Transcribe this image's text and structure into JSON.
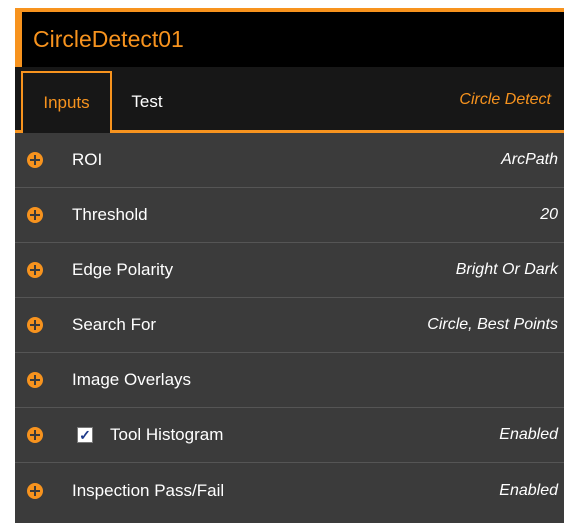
{
  "colors": {
    "accent": "#f7931e",
    "panel_bg": "#3b3b3b",
    "title_bg": "#000000",
    "tab_bg": "#171717",
    "text": "#ffffff"
  },
  "title": "CircleDetect01",
  "tabs": [
    {
      "label": "Inputs",
      "active": true
    },
    {
      "label": "Test",
      "active": false
    }
  ],
  "tool_type": "Circle Detect",
  "rows": [
    {
      "label": "ROI",
      "value": "ArcPath",
      "icon": "expand-plus-icon"
    },
    {
      "label": "Threshold",
      "value": "20",
      "icon": "expand-plus-icon"
    },
    {
      "label": "Edge Polarity",
      "value": "Bright Or Dark",
      "icon": "expand-plus-icon"
    },
    {
      "label": "Search For",
      "value": "Circle, Best Points",
      "icon": "expand-plus-icon"
    },
    {
      "label": "Image Overlays",
      "value": "",
      "icon": "expand-plus-icon"
    },
    {
      "label": "Tool Histogram",
      "value": "Enabled",
      "icon": "expand-plus-icon",
      "checked": true
    },
    {
      "label": "Inspection Pass/Fail",
      "value": "Enabled",
      "icon": "expand-plus-icon"
    }
  ]
}
